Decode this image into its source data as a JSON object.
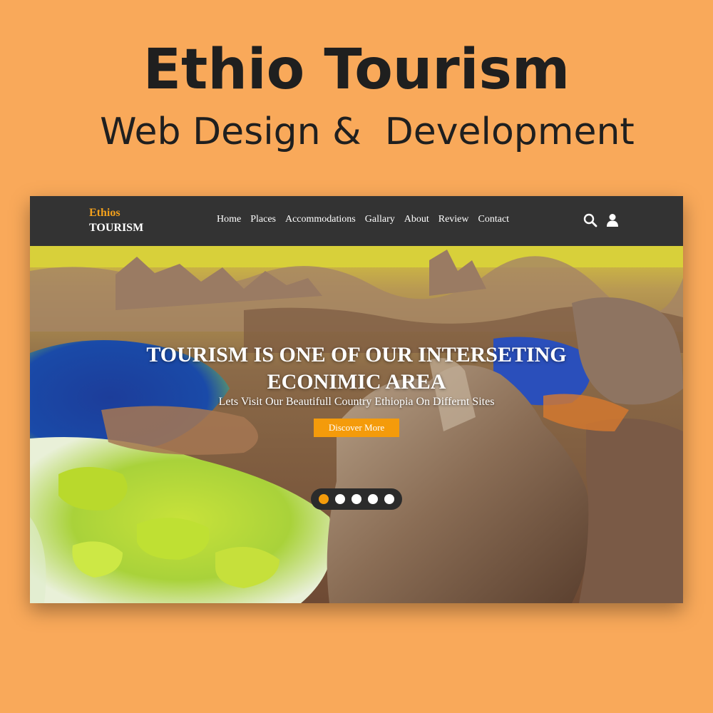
{
  "poster": {
    "title": "Ethio Tourism",
    "subtitle": "Web Design &  Development"
  },
  "site": {
    "logo": {
      "top": "Ethios",
      "bottom": "TOURISM"
    },
    "nav": {
      "items": [
        "Home",
        "Places",
        "Accommodations",
        "Gallary",
        "About",
        "Review",
        "Contact"
      ],
      "icons": [
        "search-icon",
        "user-icon"
      ]
    },
    "hero": {
      "headline_line1": "TOURISM IS ONE OF OUR INTERSETING",
      "headline_line2": "ECONIMIC AREA",
      "tagline": "Lets Visit Our Beautifull Country Ethiopia On Differnt Sites",
      "cta_label": "Discover More",
      "slides_total": 5,
      "active_slide": 1
    }
  },
  "colors": {
    "background": "#f9a95a",
    "navbar": "#333333",
    "accent": "#f49b0b",
    "text_dark": "#1f1f1f"
  }
}
